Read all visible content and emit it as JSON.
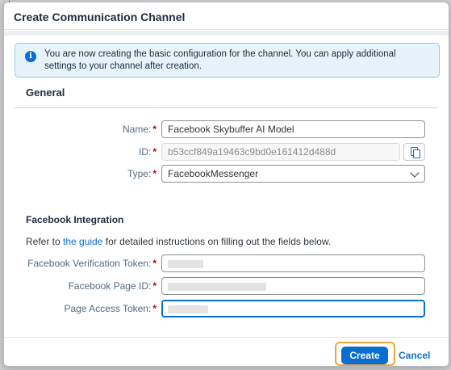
{
  "dialog": {
    "title": "Create Communication Channel",
    "info_message": "You are now creating the basic configuration for the channel. You can apply additional settings to your channel after creation."
  },
  "general": {
    "section_title": "General",
    "name": {
      "label": "Name:",
      "value": "Facebook Skybuffer AI Model"
    },
    "id": {
      "label": "ID:",
      "value": "b53ccf849a19463c9bd0e161412d488d"
    },
    "type": {
      "label": "Type:",
      "value": "FacebookMessenger"
    }
  },
  "facebook": {
    "section_title": "Facebook Integration",
    "refer_prefix": "Refer to ",
    "refer_link": "the guide",
    "refer_suffix": " for detailed instructions on filling out the fields below.",
    "verification_token": {
      "label": "Facebook Verification Token:"
    },
    "page_id": {
      "label": "Facebook Page ID:"
    },
    "access_token": {
      "label": "Page Access Token:"
    }
  },
  "footer": {
    "create_label": "Create",
    "cancel_label": "Cancel"
  },
  "icons": {
    "info": "info-icon",
    "copy": "copy-icon",
    "dropdown": "chevron-down-icon"
  },
  "colors": {
    "accent": "#0a6ed1",
    "required": "#bb0000",
    "focus_ring": "#e9a73a",
    "info_background": "#e6f3fb"
  }
}
